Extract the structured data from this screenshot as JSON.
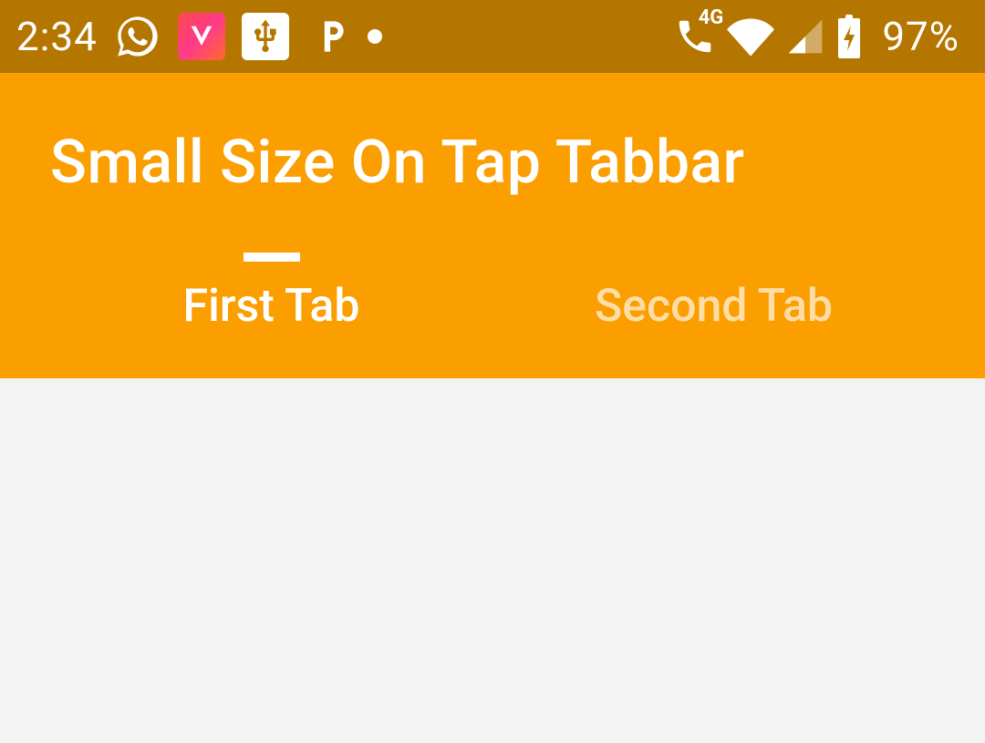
{
  "statusBar": {
    "time": "2:34",
    "batteryPercent": "97%",
    "networkLabel": "4G"
  },
  "appBar": {
    "title": "Small Size On Tap Tabbar"
  },
  "tabs": [
    {
      "label": "First Tab",
      "active": true
    },
    {
      "label": "Second Tab",
      "active": false
    }
  ]
}
